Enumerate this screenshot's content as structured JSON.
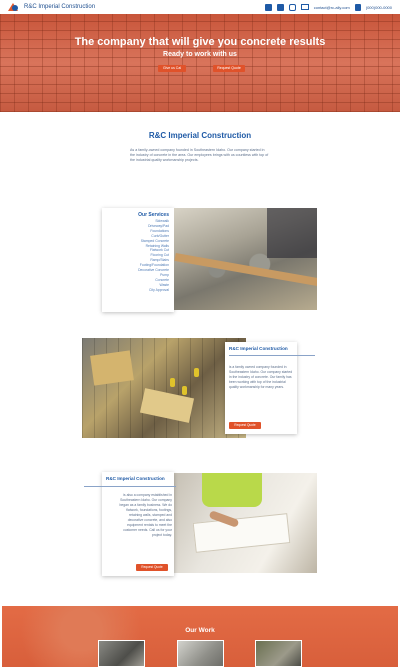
{
  "header": {
    "brand": "R&C Imperial Construction",
    "email": "contact@rc-ally.com",
    "phone": "(000)000-0000",
    "icons": [
      "facebook-icon",
      "twitter-icon",
      "instagram-icon",
      "email-icon",
      "phone-icon"
    ]
  },
  "hero": {
    "title": "The company that will give you concrete results",
    "subtitle": "Ready to work with us",
    "buttons": [
      "Give us Cal",
      "Request Quote"
    ]
  },
  "intro": {
    "title": "R&C Imperial Construction",
    "text": "As a family-owned company founded in Southeastern Idaho. Our company started in the industry of concrete in the area. Our employees brings with us countless with top of the industrial quality workmanship projects."
  },
  "services": {
    "title": "Our Services",
    "items": [
      "Sidewalk",
      "Driveway/Pad",
      "Foundations",
      "Curb/Gutter",
      "Stamped Concrete",
      "Retaining Walls",
      "Flatwork Cut",
      "Flooring Cut",
      "Ramp/Stairs",
      "Footing/Foundation",
      "Decorative Concrete",
      "Pump",
      "Concrete",
      "Waste",
      "City Approval"
    ]
  },
  "about1": {
    "title": "R&C Imperial Construction",
    "text": "is a family owned company founded in Southeastern Idaho. Our company started in the industry of concrete. Our family has been working with top of the industrial quality workmanship for many years.",
    "button": "Request Quote"
  },
  "about2": {
    "title": "R&C Imperial Construction",
    "text": "is also a company established in Southeastern Idaho. Our company began as a family business. We do flatwork, foundations, footings, retaining walls, stamped and decorative concrete, and also equipment rentals to meet the customer needs. Call us for your project today.",
    "button": "Request Quote"
  },
  "work": {
    "title": "Our Work"
  },
  "colors": {
    "accent": "#e0522a",
    "brand_blue": "#1f5aa6"
  }
}
